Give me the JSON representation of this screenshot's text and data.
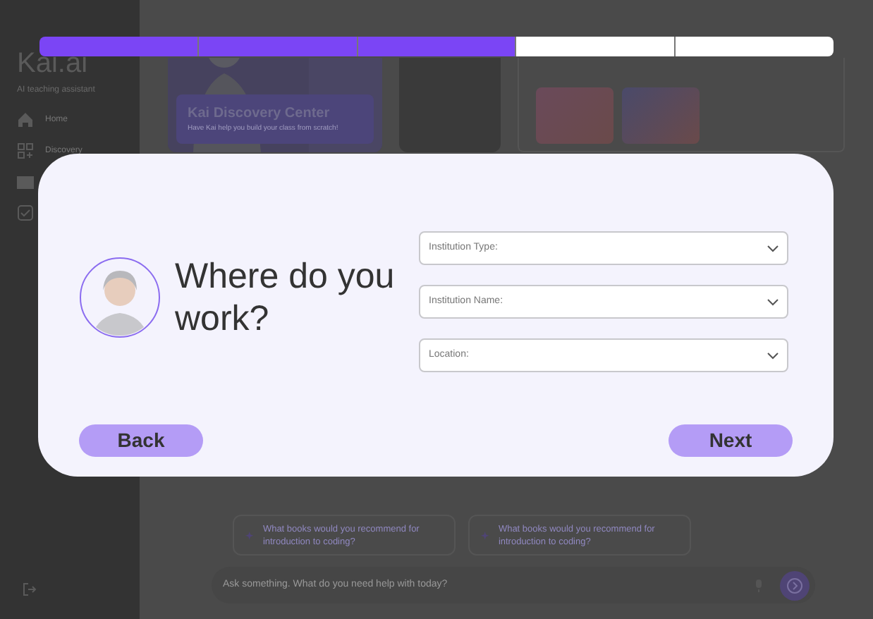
{
  "sidebar": {
    "logo": "Kai.ai",
    "tagline": "AI teaching assistant",
    "items": [
      {
        "label": "Home"
      },
      {
        "label": "Discovery"
      }
    ]
  },
  "hero": {
    "title": "Kai Discovery Center",
    "subtitle": "Have Kai help you build your class from scratch!"
  },
  "suggestions": [
    "What books would you recommend for introduction to coding?",
    "What books would you recommend for introduction to coding?"
  ],
  "chat_input": {
    "placeholder": "Ask something. What  do you need help with today?"
  },
  "progress": [
    {
      "done": true
    },
    {
      "done": true
    },
    {
      "done": true
    },
    {
      "done": false
    },
    {
      "done": false
    }
  ],
  "dialog": {
    "question": "Where do you work?",
    "fields": [
      {
        "placeholder": "Institution Type:"
      },
      {
        "placeholder": "Institution Name:"
      },
      {
        "placeholder": "Location:"
      }
    ],
    "buttons": [
      "Back",
      "Next"
    ]
  }
}
